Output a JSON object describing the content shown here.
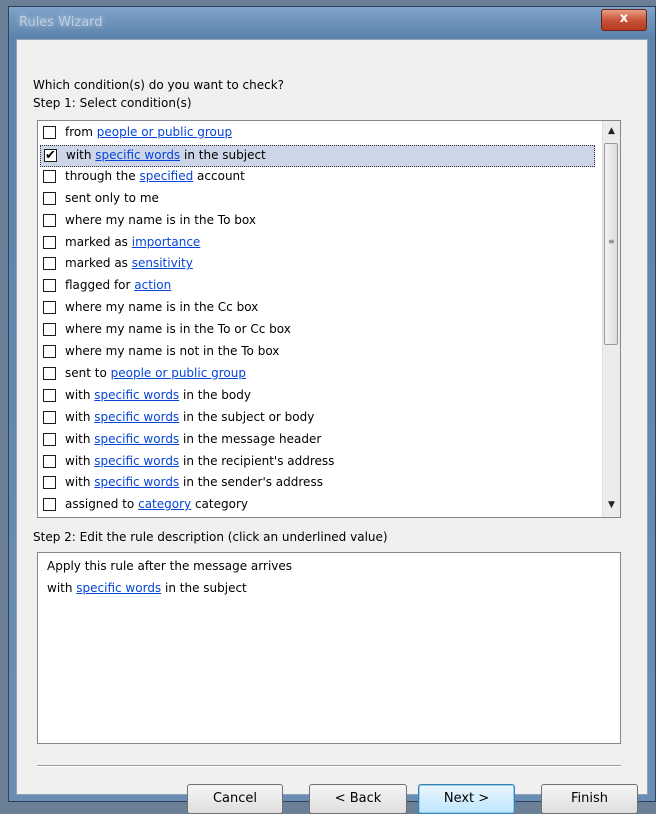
{
  "window": {
    "title": "Rules Wizard"
  },
  "prompt": "Which condition(s) do you want to check?",
  "step1_label": "Step 1: Select condition(s)",
  "conditions": [
    {
      "a": "from ",
      "link": "people or public group",
      "b": "",
      "checked": false
    },
    {
      "a": "with ",
      "link": "specific words",
      "b": " in the subject",
      "checked": true
    },
    {
      "a": "through the ",
      "link": "specified",
      "b": " account",
      "checked": false
    },
    {
      "a": "sent only to me",
      "link": "",
      "b": "",
      "checked": false
    },
    {
      "a": "where my name is in the To box",
      "link": "",
      "b": "",
      "checked": false
    },
    {
      "a": "marked as ",
      "link": "importance",
      "b": "",
      "checked": false
    },
    {
      "a": "marked as ",
      "link": "sensitivity",
      "b": "",
      "checked": false
    },
    {
      "a": "flagged for ",
      "link": "action",
      "b": "",
      "checked": false
    },
    {
      "a": "where my name is in the Cc box",
      "link": "",
      "b": "",
      "checked": false
    },
    {
      "a": "where my name is in the To or Cc box",
      "link": "",
      "b": "",
      "checked": false
    },
    {
      "a": "where my name is not in the To box",
      "link": "",
      "b": "",
      "checked": false
    },
    {
      "a": "sent to ",
      "link": "people or public group",
      "b": "",
      "checked": false
    },
    {
      "a": "with ",
      "link": "specific words",
      "b": " in the body",
      "checked": false
    },
    {
      "a": "with ",
      "link": "specific words",
      "b": " in the subject or body",
      "checked": false
    },
    {
      "a": "with ",
      "link": "specific words",
      "b": " in the message header",
      "checked": false
    },
    {
      "a": "with ",
      "link": "specific words",
      "b": " in the recipient's address",
      "checked": false
    },
    {
      "a": "with ",
      "link": "specific words",
      "b": " in the sender's address",
      "checked": false
    },
    {
      "a": "assigned to ",
      "link": "category",
      "b": " category",
      "checked": false
    }
  ],
  "step2_label": "Step 2: Edit the rule description (click an underlined value)",
  "description": {
    "line1": "Apply this rule after the message arrives",
    "line2_pre": "with ",
    "line2_link": "specific words",
    "line2_post": " in the subject"
  },
  "buttons": {
    "cancel": "Cancel",
    "back": "< Back",
    "next": "Next >",
    "finish": "Finish"
  },
  "checkmark": "✔",
  "icons": {
    "close": "x",
    "scroll_up": "▲",
    "scroll_down": "▼",
    "grip": "≡"
  }
}
